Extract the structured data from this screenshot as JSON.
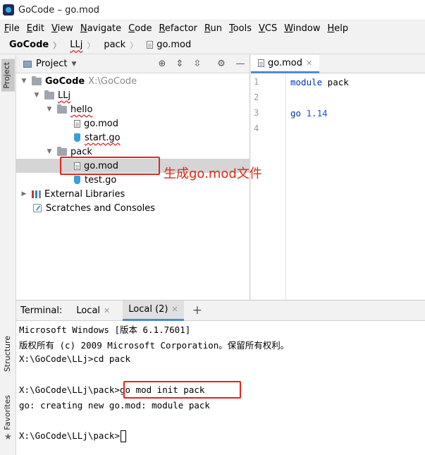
{
  "window": {
    "title": "GoCode – go.mod"
  },
  "menu": [
    {
      "mnemonic": "F",
      "rest": "ile"
    },
    {
      "mnemonic": "E",
      "rest": "dit"
    },
    {
      "mnemonic": "V",
      "rest": "iew"
    },
    {
      "mnemonic": "N",
      "rest": "avigate"
    },
    {
      "mnemonic": "C",
      "rest": "ode"
    },
    {
      "mnemonic": "R",
      "rest": "efactor"
    },
    {
      "mnemonic": "R",
      "rest": "un"
    },
    {
      "mnemonic": "T",
      "rest": "ools"
    },
    {
      "mnemonic": "V",
      "rest": "CS"
    },
    {
      "mnemonic": "W",
      "rest": "indow"
    },
    {
      "mnemonic": "H",
      "rest": "elp"
    }
  ],
  "breadcrumb": [
    "GoCode",
    "LLj",
    "pack",
    "go.mod"
  ],
  "side_tabs": {
    "project": "Project",
    "structure": "Structure",
    "favorites": "Favorites"
  },
  "project": {
    "title": "Project",
    "tree": {
      "root": {
        "name": "GoCode",
        "path": "X:\\GoCode"
      },
      "llj": "LLj",
      "hello": "hello",
      "hello_gomod": "go.mod",
      "hello_start": "start.go",
      "pack": "pack",
      "pack_gomod": "go.mod",
      "pack_test": "test.go",
      "external": "External Libraries",
      "scratches": "Scratches and Consoles"
    }
  },
  "editor": {
    "tab": "go.mod",
    "line_numbers": [
      "1",
      "2",
      "3",
      "4"
    ],
    "line1": {
      "keyword": "module",
      "text": " pack"
    },
    "line3": {
      "keyword": "go",
      "number": " 1.14"
    }
  },
  "terminal": {
    "label": "Terminal:",
    "tabs": [
      "Local",
      "Local (2)"
    ],
    "lines": [
      "Microsoft Windows [版本 6.1.7601]",
      "版权所有 (c) 2009 Microsoft Corporation。保留所有权利。",
      "X:\\GoCode\\LLj>cd pack",
      "",
      "X:\\GoCode\\LLj\\pack>go mod init pack",
      "go: creating new go.mod: module pack",
      "",
      "X:\\GoCode\\LLj\\pack>"
    ]
  },
  "annotation": "生成go.mod文件",
  "colors": {
    "highlight": "#e0261b",
    "keyword": "#0033b3",
    "tab_accent": "#4d8ad6"
  }
}
